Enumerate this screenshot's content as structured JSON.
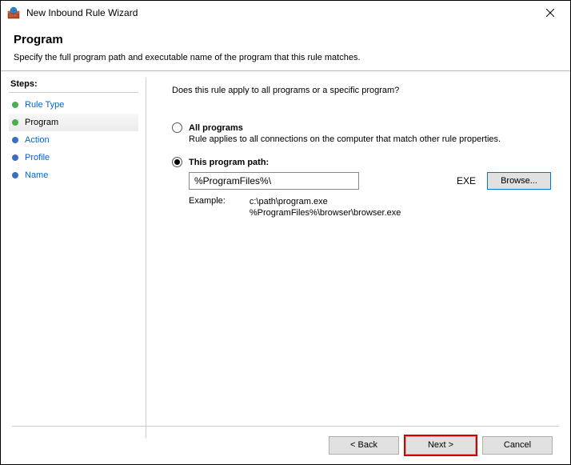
{
  "window": {
    "title": "New Inbound Rule Wizard"
  },
  "header": {
    "page_title": "Program",
    "description": "Specify the full program path and executable name of the program that this rule matches."
  },
  "sidebar": {
    "title": "Steps:",
    "items": [
      {
        "label": "Rule Type"
      },
      {
        "label": "Program"
      },
      {
        "label": "Action"
      },
      {
        "label": "Profile"
      },
      {
        "label": "Name"
      }
    ]
  },
  "main": {
    "question": "Does this rule apply to all programs or a specific program?",
    "all_programs": {
      "label": "All programs",
      "desc": "Rule applies to all connections on the computer that match other rule properties."
    },
    "this_program": {
      "label": "This program path:",
      "value": "%ProgramFiles%\\",
      "ext_hint": "EXE",
      "browse": "Browse..."
    },
    "example": {
      "label": "Example:",
      "line1": "c:\\path\\program.exe",
      "line2": "%ProgramFiles%\\browser\\browser.exe"
    }
  },
  "footer": {
    "back": "< Back",
    "next": "Next >",
    "cancel": "Cancel"
  }
}
